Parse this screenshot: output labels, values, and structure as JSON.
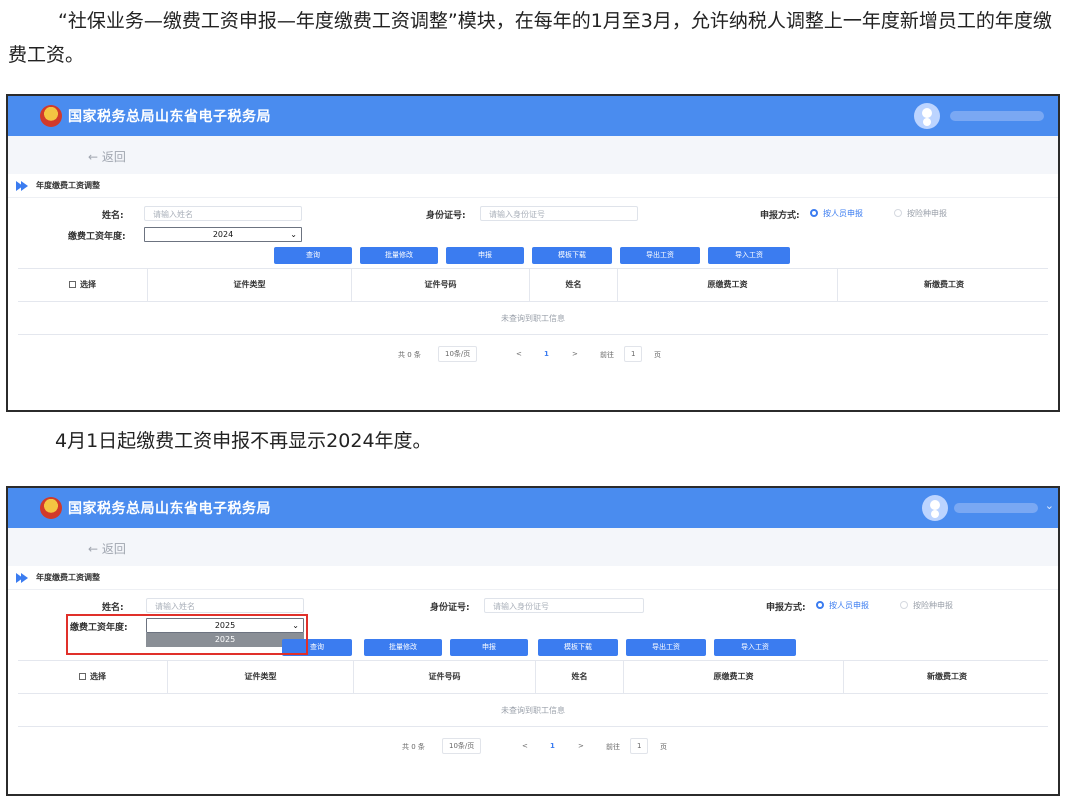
{
  "article": {
    "para1": "“社保业务—缴费工资申报—年度缴费工资调整”模块，在每年的1月至3月，允许纳税人调整上一年度新增员工的年度缴费工资。",
    "para2": "4月1日起缴费工资申报不再显示2024年度。"
  },
  "app": {
    "brand": "国家税务总局山东省电子税务局",
    "back": "← 返回",
    "module_title": "年度缴费工资调整",
    "form": {
      "name_label": "姓名:",
      "name_placeholder": "请输入姓名",
      "id_label": "身份证号:",
      "id_placeholder": "请输入身份证号",
      "report_label": "申报方式:",
      "report_by_person": "按人员申报",
      "report_by_type": "按险种申报",
      "year_label": "缴费工资年度:"
    },
    "buttons": {
      "query": "查询",
      "batch_edit": "批量修改",
      "declare": "申报",
      "template_download": "模板下载",
      "export_wage": "导出工资",
      "import_wage": "导入工资"
    },
    "table": {
      "headers": [
        "选择",
        "证件类型",
        "证件号码",
        "姓名",
        "原缴费工资",
        "新缴费工资"
      ],
      "empty": "未查询到职工信息"
    },
    "pager": {
      "total": "共 0 条",
      "page_size": "10条/页",
      "prev": "<",
      "current": "1",
      "next": ">",
      "goto": "前往",
      "goto_value": "1",
      "page_unit": "页"
    }
  },
  "screenshot1": {
    "year_value": "2024"
  },
  "screenshot2": {
    "year_value": "2025",
    "dropdown_option": "2025"
  },
  "colors": {
    "accent": "#3b7cf0",
    "topbar": "#4a8cef",
    "highlight": "#e0302a"
  }
}
